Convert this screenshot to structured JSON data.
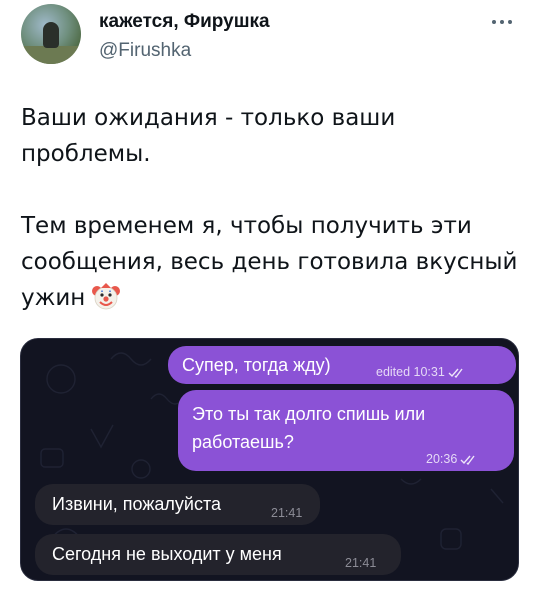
{
  "author": {
    "display_name": "кажется, Фирушка",
    "handle": "@Firushka"
  },
  "tweet": {
    "lines_1": [
      "Ваши ожидания - только ваши",
      "проблемы."
    ],
    "lines_2": [
      "Тем временем я, чтобы получить эти",
      "сообщения, весь день готовила вкусный",
      "ужин"
    ],
    "emoji": "clown-face-icon"
  },
  "chat": {
    "messages": [
      {
        "direction": "outgoing",
        "text": "Супер, тогда жду)",
        "meta": "edited 10:31",
        "status": "read"
      },
      {
        "direction": "outgoing",
        "text": "Это ты так долго спишь или работаешь?",
        "meta": "20:36",
        "status": "read"
      },
      {
        "direction": "incoming",
        "text": "Извини, пожалуйста",
        "meta": "21:41"
      },
      {
        "direction": "incoming",
        "text": "Сегодня не выходит у меня",
        "meta": "21:41"
      }
    ]
  },
  "colors": {
    "outgoing_bubble": "#8b52d6",
    "incoming_bubble": "#23232c",
    "chat_background": "#121421",
    "handle_text": "#536471"
  }
}
